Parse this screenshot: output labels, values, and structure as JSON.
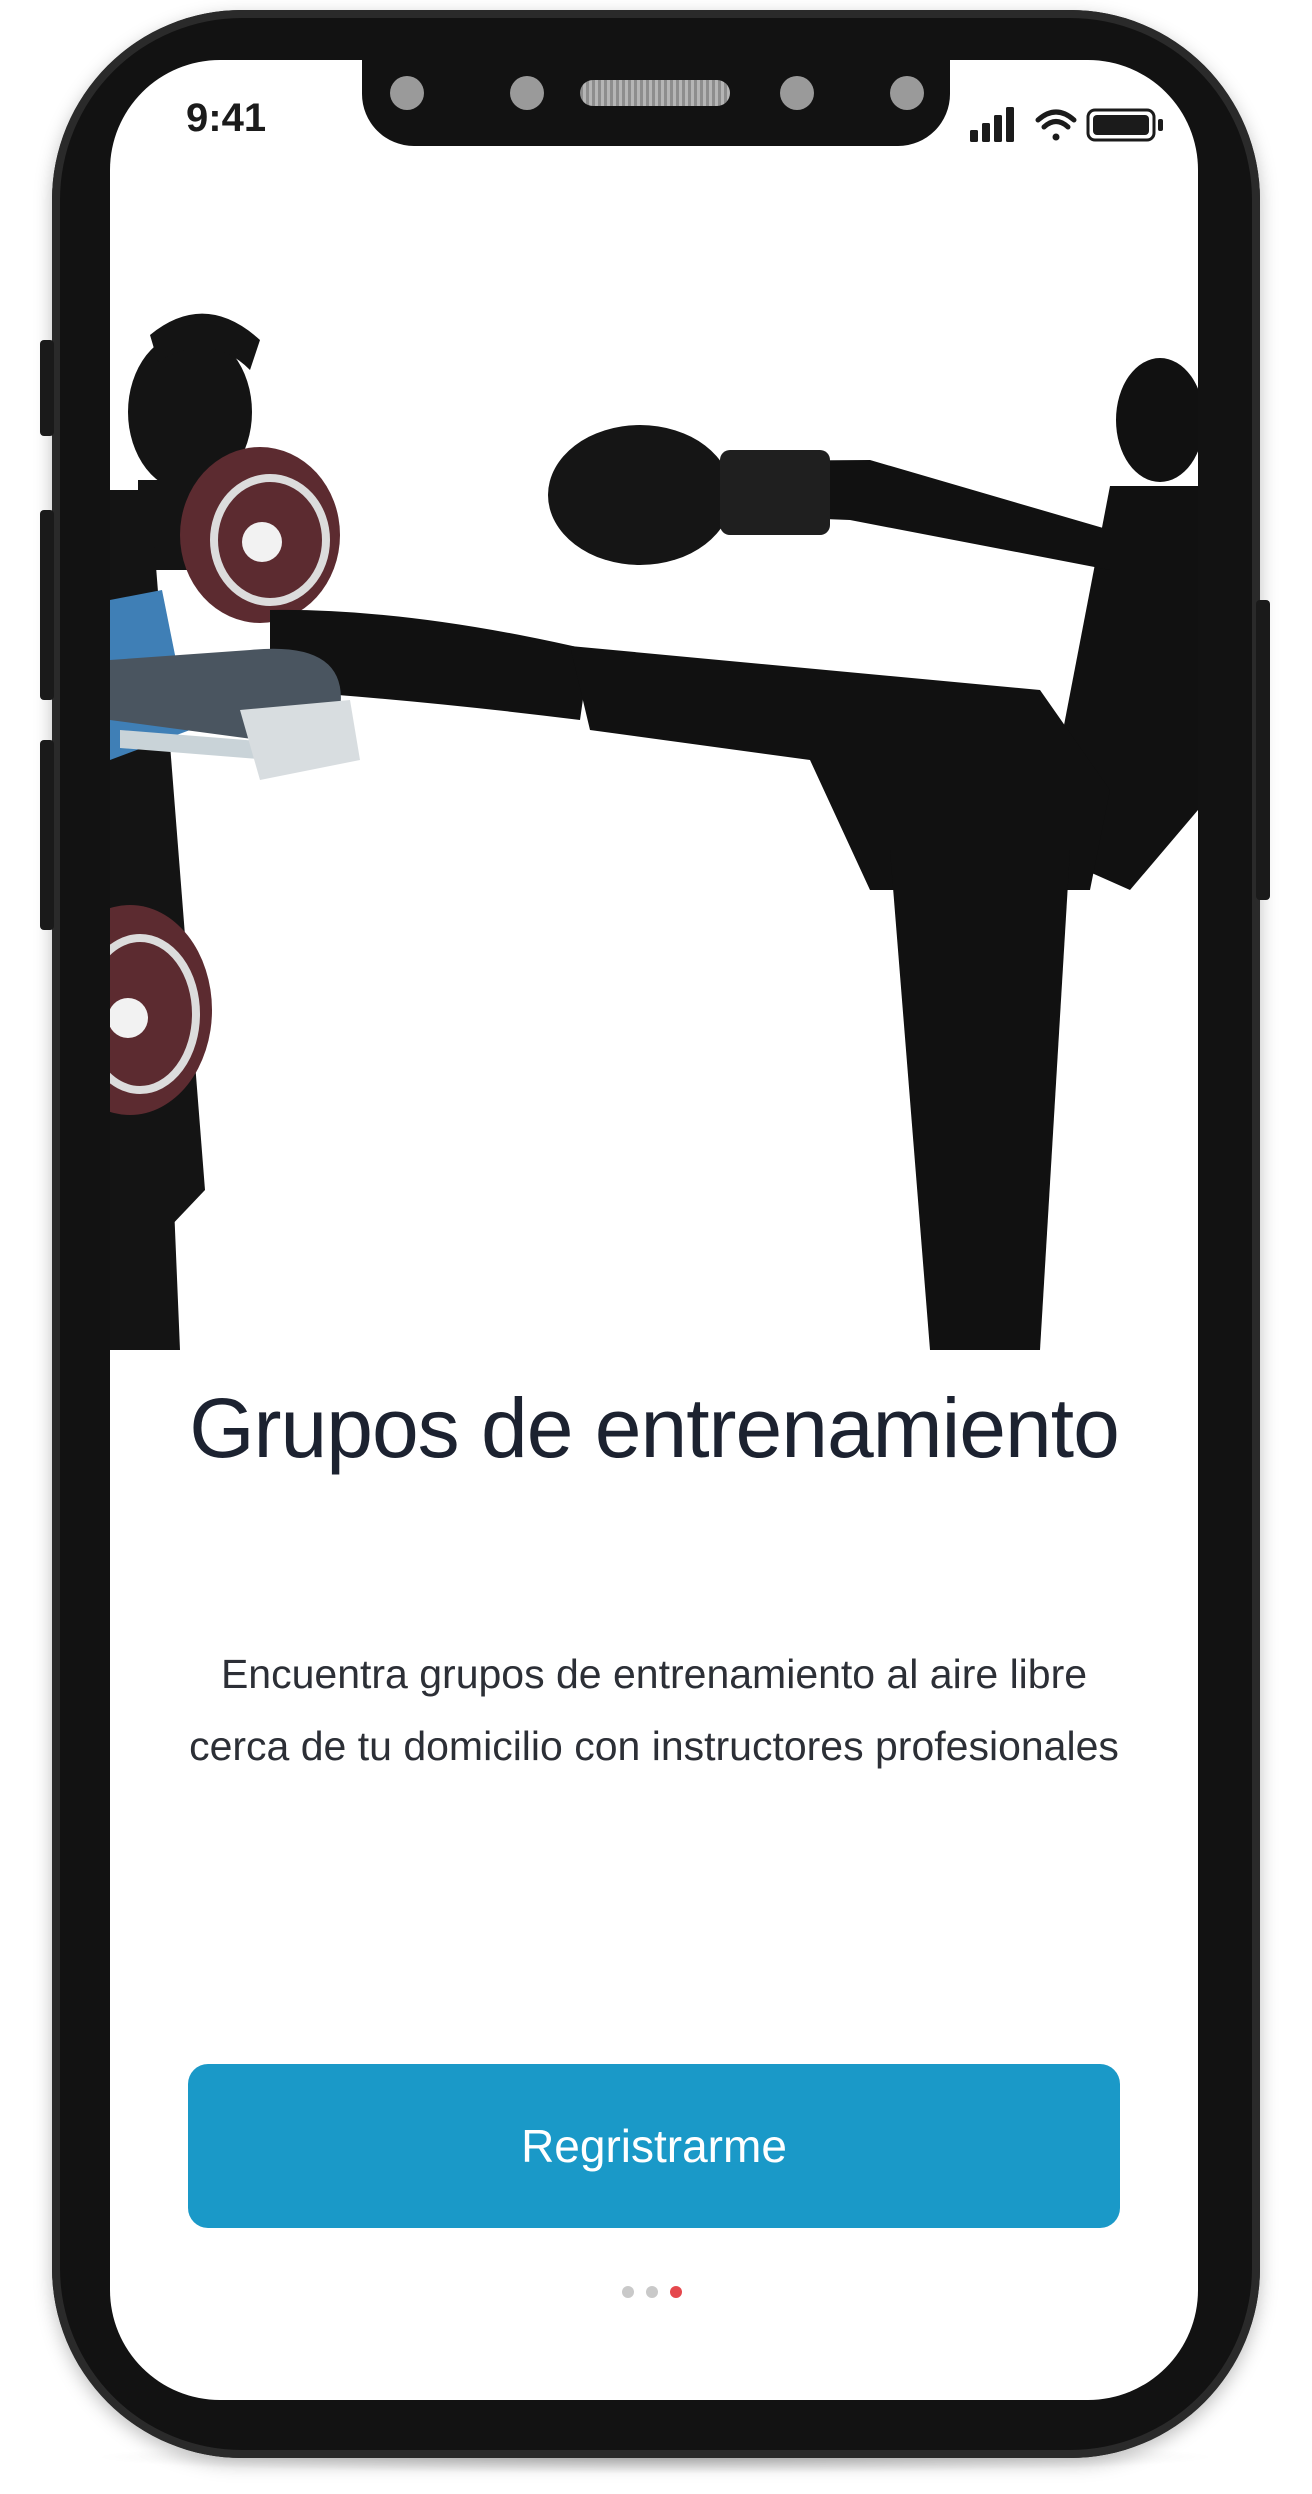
{
  "status_bar": {
    "time": "9:41"
  },
  "onboarding": {
    "title": "Grupos de entrenamiento",
    "description": "Encuentra grupos de entrenamiento al aire libre cerca de tu domicilio con instructores profesionales",
    "cta_label": "Regristrarme",
    "page_indicator": {
      "total": 3,
      "active_index": 2
    }
  },
  "colors": {
    "accent": "#1a99c8",
    "title": "#1c2230",
    "body_text": "#2c2f36",
    "dot_active": "#e5484d",
    "dot_inactive": "#c9c9c9"
  },
  "icons": [
    "cellular-signal-icon",
    "wifi-icon",
    "battery-icon"
  ]
}
